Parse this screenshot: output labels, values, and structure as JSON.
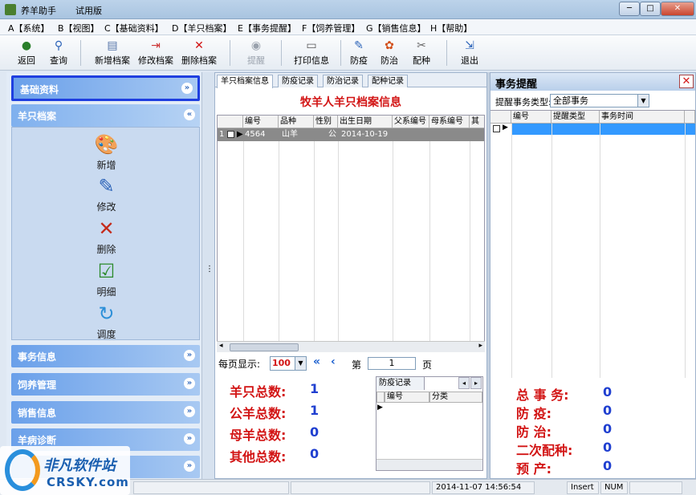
{
  "window": {
    "app_title": "养羊助手",
    "edition": "试用版",
    "min": "─",
    "max": "□",
    "close": "✕"
  },
  "menu": [
    "A【系统】",
    "B【视图】",
    "C【基础资料】",
    "D【羊只档案】",
    "E【事务提醒】",
    "F【饲养管理】",
    "G【销售信息】",
    "H【帮助】"
  ],
  "toolbar": {
    "back": "返回",
    "query": "查询",
    "new_record": "新增档案",
    "edit_record": "修改档案",
    "delete_record": "删除档案",
    "remind": "提醒",
    "print": "打印信息",
    "prevent": "防疫",
    "treat": "防治",
    "breed": "配种",
    "exit": "退出"
  },
  "sidebar": {
    "basic": "基础资料",
    "sheep": "羊只档案",
    "sheep_items": [
      "新增",
      "修改",
      "删除",
      "明细",
      "调度"
    ],
    "affairs": "事务信息",
    "feeding": "饲养管理",
    "sales": "销售信息",
    "disease": "羊病诊断",
    "chev_down": "»",
    "chev_up": "«"
  },
  "center": {
    "tabs": [
      "羊只档案信息",
      "防疫记录",
      "防治记录",
      "配种记录"
    ],
    "title": "牧羊人羊只档案信息",
    "columns": [
      "编号",
      "品种",
      "性别",
      "出生日期",
      "父系编号",
      "母系编号",
      "其他"
    ],
    "row": {
      "index": "1",
      "id": "4564",
      "breed": "山羊",
      "sex": "公",
      "birth": "2014-10-19"
    },
    "pager": {
      "label": "每页显示:",
      "size": "100",
      "first": "«",
      "prev": "‹",
      "page_prefix": "第",
      "page": "1",
      "page_suffix": "页"
    },
    "stats": [
      {
        "label": "羊只总数:",
        "value": "1"
      },
      {
        "label": "公羊总数:",
        "value": "1"
      },
      {
        "label": "母羊总数:",
        "value": "0"
      },
      {
        "label": "其他总数:",
        "value": "0"
      }
    ],
    "subgrid": {
      "tab": "防疫记录",
      "columns": [
        "编号",
        "分类"
      ]
    }
  },
  "right": {
    "title": "事务提醒",
    "close": "✕",
    "type_label": "提醒事务类型:",
    "type_value": "全部事务",
    "columns": [
      "编号",
      "提醒类型",
      "事务时间"
    ],
    "stats": [
      {
        "label": "总 事 务:",
        "value": "0"
      },
      {
        "label": "防    疫:",
        "value": "0"
      },
      {
        "label": "防    治:",
        "value": "0"
      },
      {
        "label": "二次配种:",
        "value": "0"
      },
      {
        "label": "预    产:",
        "value": "0"
      }
    ]
  },
  "status": {
    "datetime": "2014-11-07 14:56:54",
    "insert": "Insert",
    "num": "NUM"
  },
  "watermark": {
    "brand": "非凡软件站",
    "domain": "CRSKY.com"
  }
}
